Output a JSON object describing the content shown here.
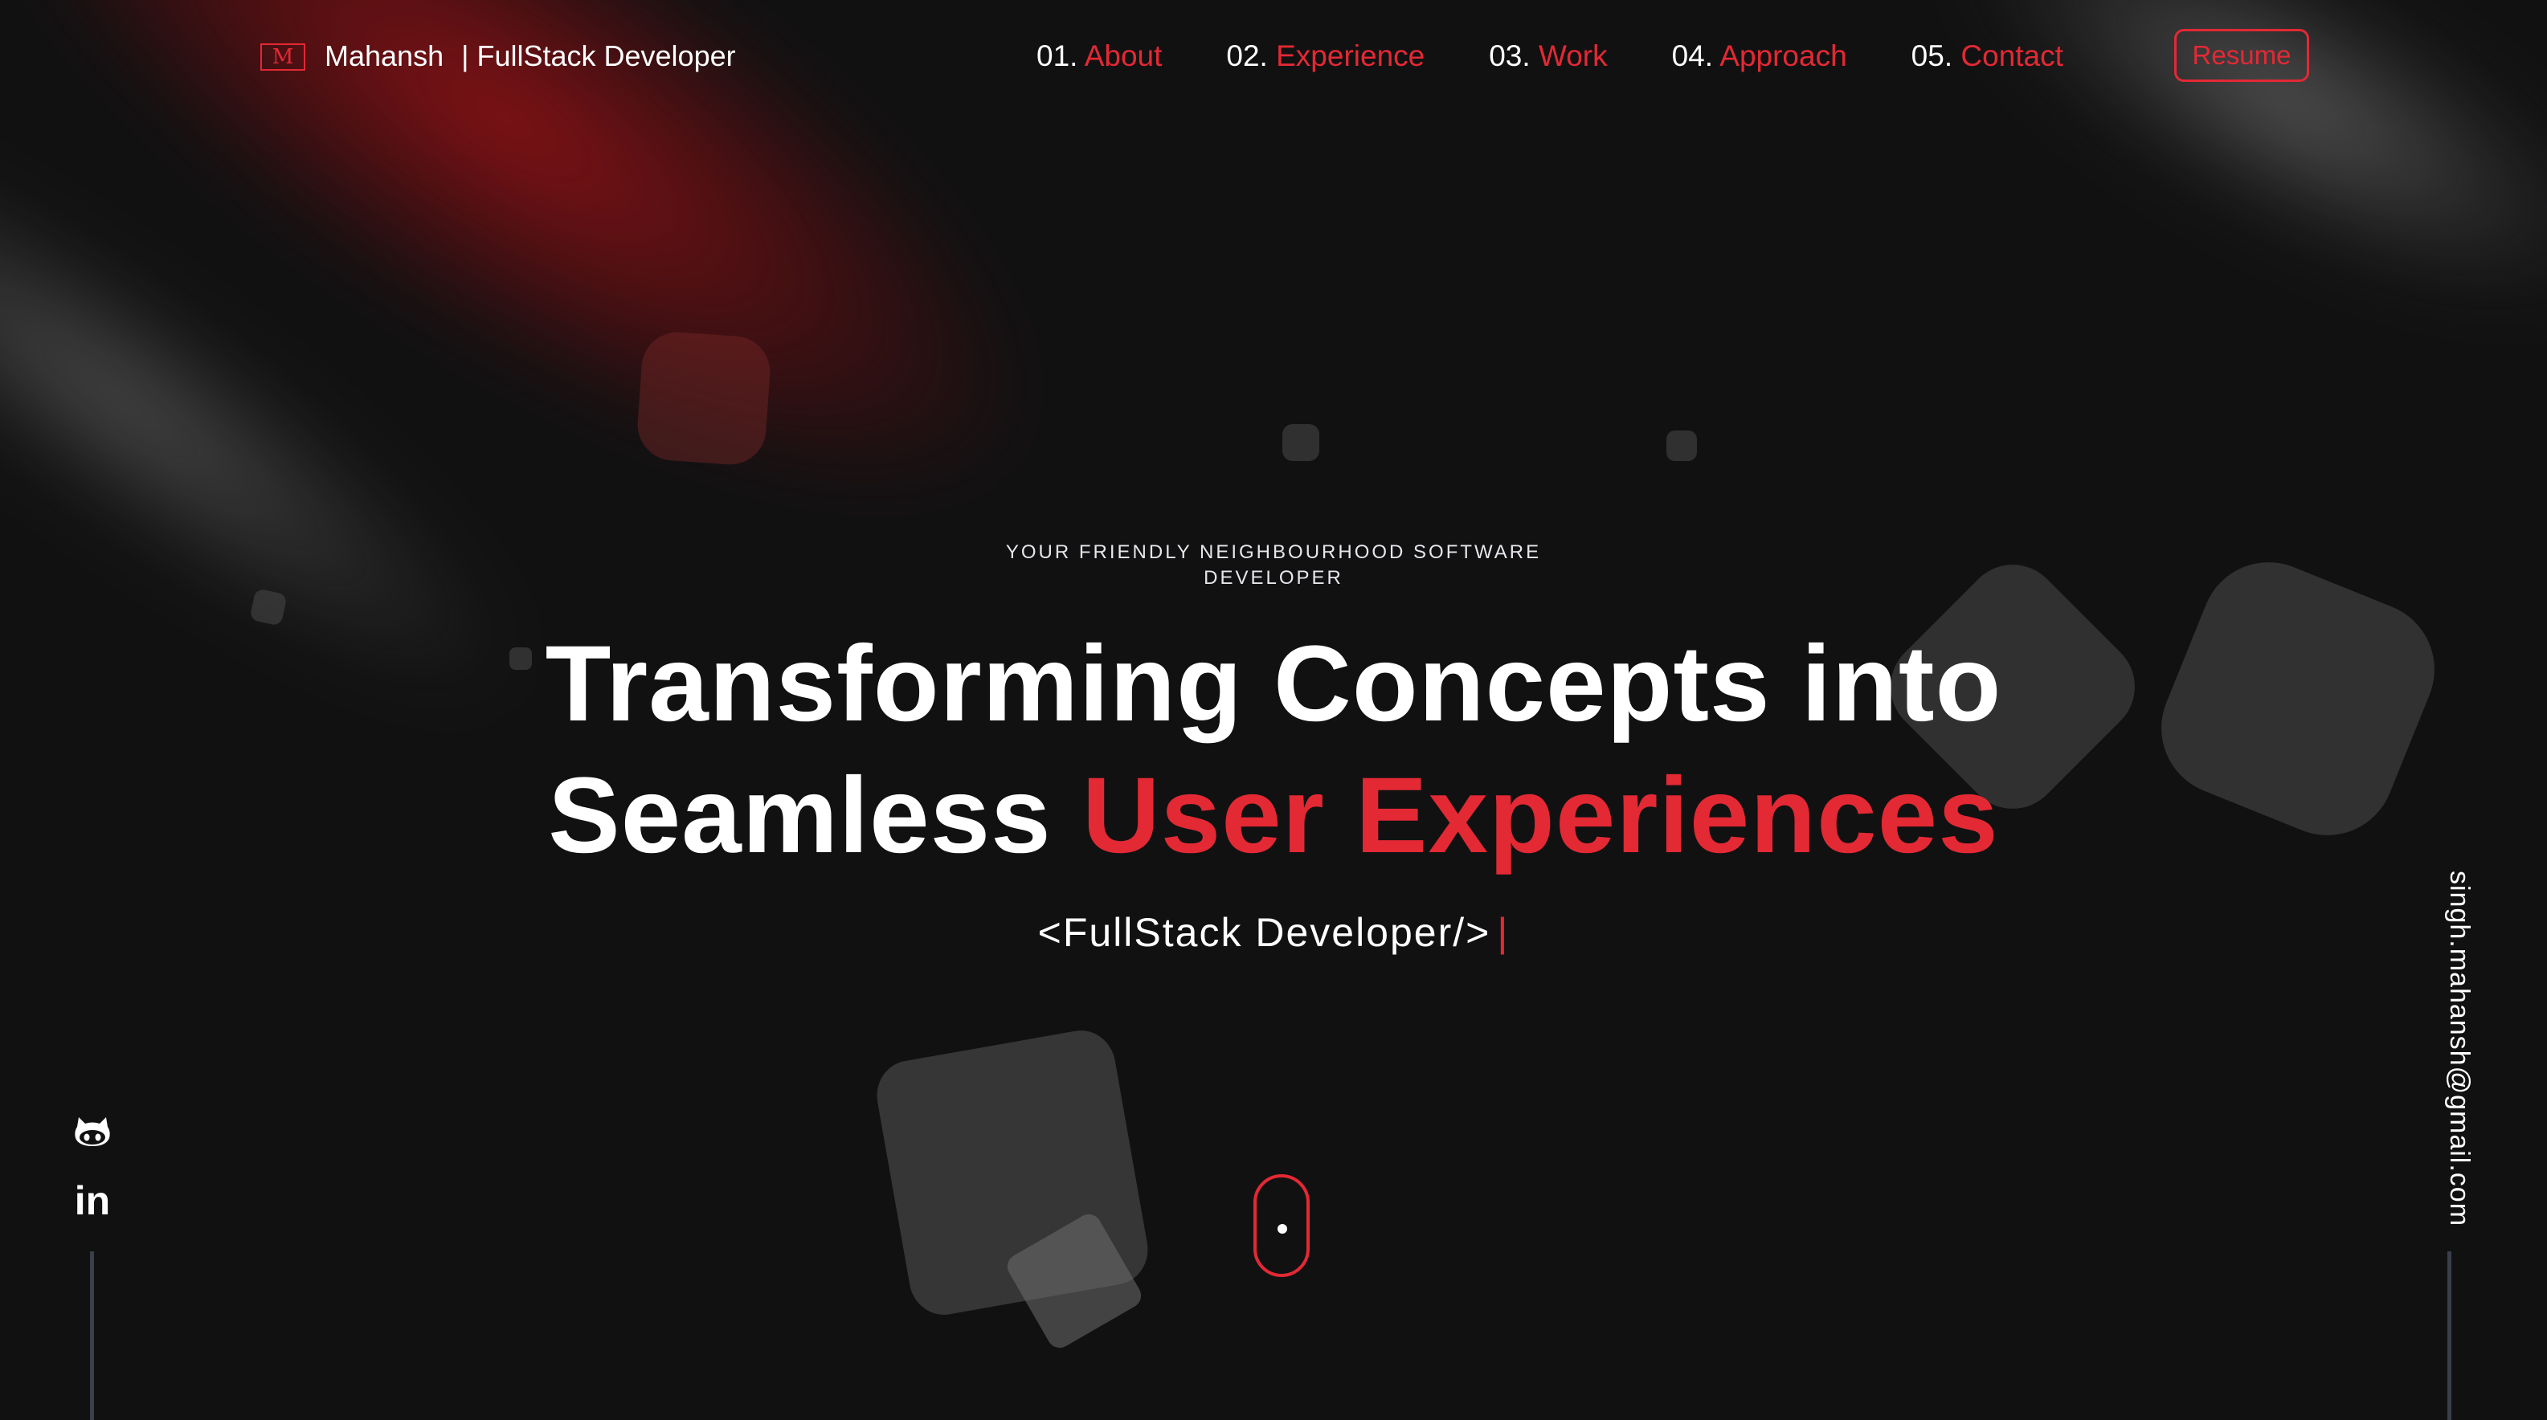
{
  "header": {
    "logo_letter": "M",
    "brand_name": "Mahansh",
    "brand_tagline": "| FullStack Developer",
    "nav": [
      {
        "num": "01.",
        "label": "About"
      },
      {
        "num": "02.",
        "label": "Experience"
      },
      {
        "num": "03.",
        "label": "Work"
      },
      {
        "num": "04.",
        "label": "Approach"
      },
      {
        "num": "05.",
        "label": "Contact"
      }
    ],
    "resume_label": "Resume"
  },
  "hero": {
    "eyebrow": "YOUR FRIENDLY NEIGHBOURHOOD SOFTWARE DEVELOPER",
    "headline_line1": "Transforming Concepts into",
    "headline_line2_plain": "Seamless ",
    "headline_line2_accent": "User Experiences",
    "subline": "<FullStack Developer/>",
    "cursor": "|"
  },
  "sidebar": {
    "email": "singh.mahansh@gmail.com",
    "linkedin_label": "in"
  },
  "icons": {
    "github": "github-icon",
    "linkedin": "linkedin-icon",
    "scroll": "mouse-scroll-icon"
  },
  "colors": {
    "accent": "#e32934",
    "background": "#111112",
    "text": "#ffffff"
  }
}
